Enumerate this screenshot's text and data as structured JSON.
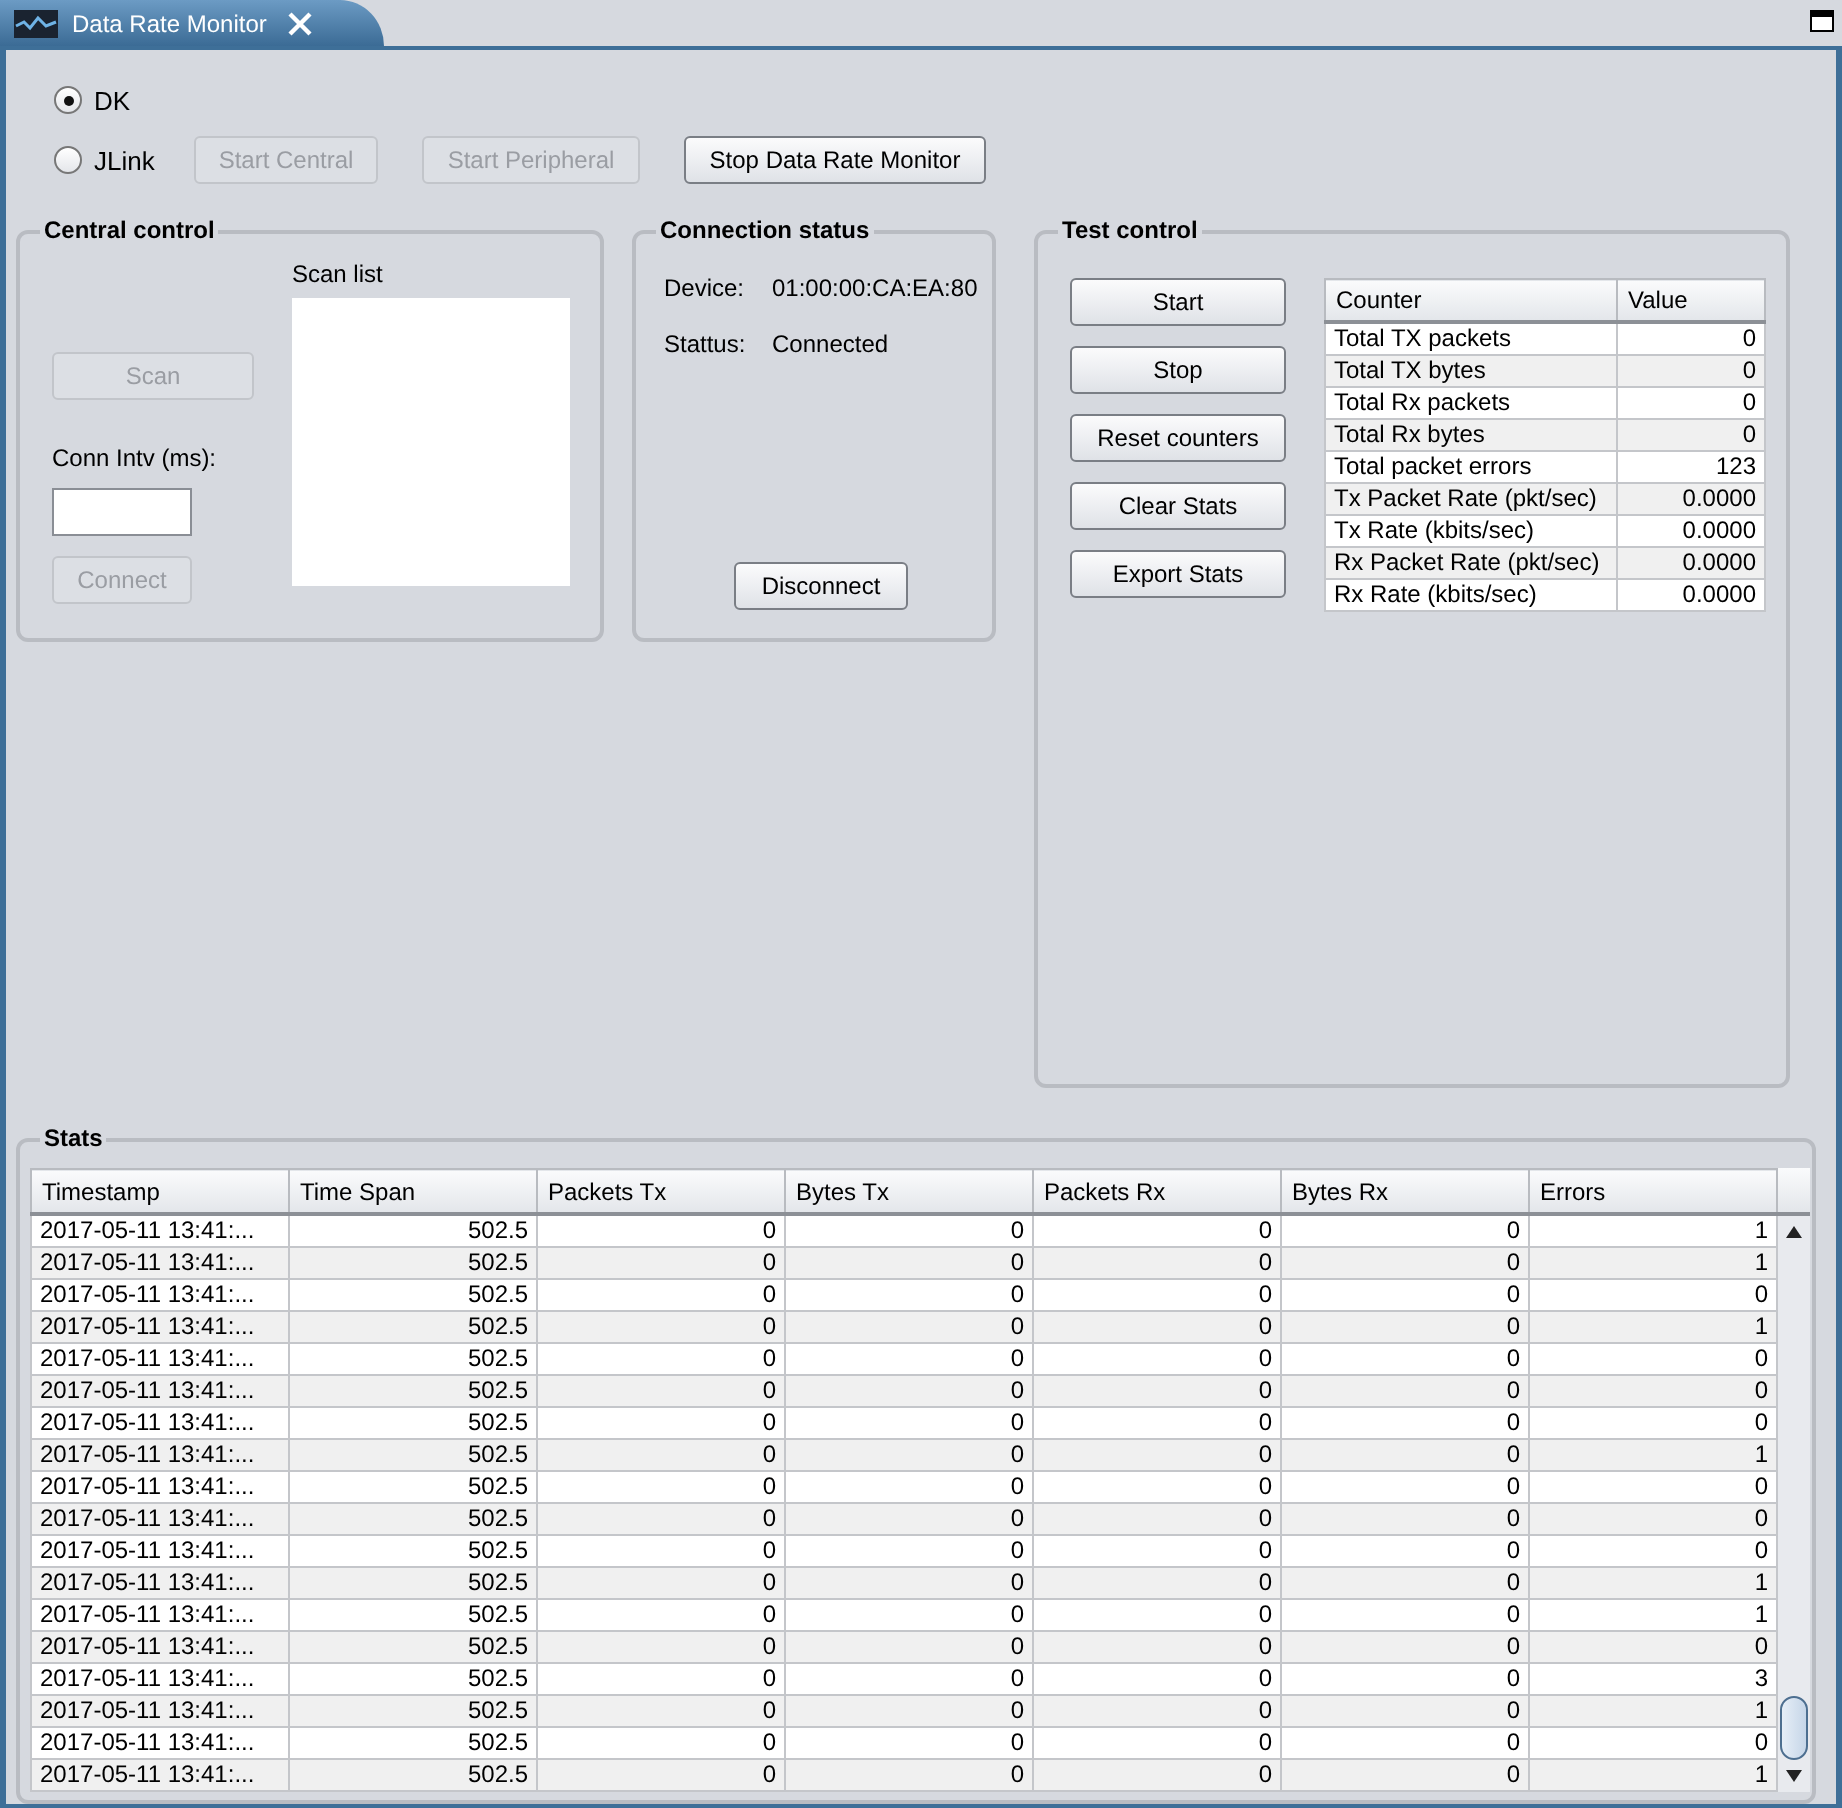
{
  "tab": {
    "title": "Data Rate Monitor"
  },
  "radios": [
    {
      "label": "DK",
      "selected": true
    },
    {
      "label": "JLink",
      "selected": false
    }
  ],
  "top_buttons": [
    {
      "label": "Start Central",
      "disabled": true
    },
    {
      "label": "Start Peripheral",
      "disabled": true
    },
    {
      "label": "Stop Data Rate Monitor",
      "disabled": false
    }
  ],
  "central_control": {
    "title": "Central control",
    "scan_button": {
      "label": "Scan",
      "disabled": true
    },
    "scan_list_label": "Scan list",
    "conn_intv_label": "Conn Intv (ms):",
    "connect_button": {
      "label": "Connect",
      "disabled": true
    }
  },
  "connection_status": {
    "title": "Connection status",
    "fields": [
      {
        "label": "Device:",
        "value": "01:00:00:CA:EA:80"
      },
      {
        "label": "Stattus:",
        "value": "Connected"
      }
    ],
    "disconnect_button": {
      "label": "Disconnect",
      "disabled": false
    }
  },
  "test_control": {
    "title": "Test control",
    "buttons": [
      {
        "label": "Start",
        "disabled": false
      },
      {
        "label": "Stop",
        "disabled": false
      },
      {
        "label": "Reset counters",
        "disabled": false
      },
      {
        "label": "Clear Stats",
        "disabled": false
      },
      {
        "label": "Export Stats",
        "disabled": false
      }
    ],
    "columns": [
      "Counter",
      "Value"
    ],
    "rows": [
      [
        "Total TX packets",
        "0"
      ],
      [
        "Total TX bytes",
        "0"
      ],
      [
        "Total Rx packets",
        "0"
      ],
      [
        "Total Rx bytes",
        "0"
      ],
      [
        "Total packet errors",
        "123"
      ],
      [
        "Tx Packet Rate (pkt/sec)",
        "0.0000"
      ],
      [
        "Tx Rate (kbits/sec)",
        "0.0000"
      ],
      [
        "Rx Packet Rate (pkt/sec)",
        "0.0000"
      ],
      [
        "Rx Rate (kbits/sec)",
        "0.0000"
      ]
    ]
  },
  "stats": {
    "title": "Stats",
    "columns": [
      "Timestamp",
      "Time Span",
      "Packets Tx",
      "Bytes Tx",
      "Packets Rx",
      "Bytes Rx",
      "Errors"
    ],
    "rows": [
      [
        "2017-05-11 13:41:...",
        "502.5",
        "0",
        "0",
        "0",
        "0",
        "1"
      ],
      [
        "2017-05-11 13:41:...",
        "502.5",
        "0",
        "0",
        "0",
        "0",
        "1"
      ],
      [
        "2017-05-11 13:41:...",
        "502.5",
        "0",
        "0",
        "0",
        "0",
        "0"
      ],
      [
        "2017-05-11 13:41:...",
        "502.5",
        "0",
        "0",
        "0",
        "0",
        "1"
      ],
      [
        "2017-05-11 13:41:...",
        "502.5",
        "0",
        "0",
        "0",
        "0",
        "0"
      ],
      [
        "2017-05-11 13:41:...",
        "502.5",
        "0",
        "0",
        "0",
        "0",
        "0"
      ],
      [
        "2017-05-11 13:41:...",
        "502.5",
        "0",
        "0",
        "0",
        "0",
        "0"
      ],
      [
        "2017-05-11 13:41:...",
        "502.5",
        "0",
        "0",
        "0",
        "0",
        "1"
      ],
      [
        "2017-05-11 13:41:...",
        "502.5",
        "0",
        "0",
        "0",
        "0",
        "0"
      ],
      [
        "2017-05-11 13:41:...",
        "502.5",
        "0",
        "0",
        "0",
        "0",
        "0"
      ],
      [
        "2017-05-11 13:41:...",
        "502.5",
        "0",
        "0",
        "0",
        "0",
        "0"
      ],
      [
        "2017-05-11 13:41:...",
        "502.5",
        "0",
        "0",
        "0",
        "0",
        "1"
      ],
      [
        "2017-05-11 13:41:...",
        "502.5",
        "0",
        "0",
        "0",
        "0",
        "1"
      ],
      [
        "2017-05-11 13:41:...",
        "502.5",
        "0",
        "0",
        "0",
        "0",
        "0"
      ],
      [
        "2017-05-11 13:41:...",
        "502.5",
        "0",
        "0",
        "0",
        "0",
        "3"
      ],
      [
        "2017-05-11 13:41:...",
        "502.5",
        "0",
        "0",
        "0",
        "0",
        "1"
      ],
      [
        "2017-05-11 13:41:...",
        "502.5",
        "0",
        "0",
        "0",
        "0",
        "0"
      ],
      [
        "2017-05-11 13:41:...",
        "502.5",
        "0",
        "0",
        "0",
        "0",
        "1"
      ]
    ]
  }
}
